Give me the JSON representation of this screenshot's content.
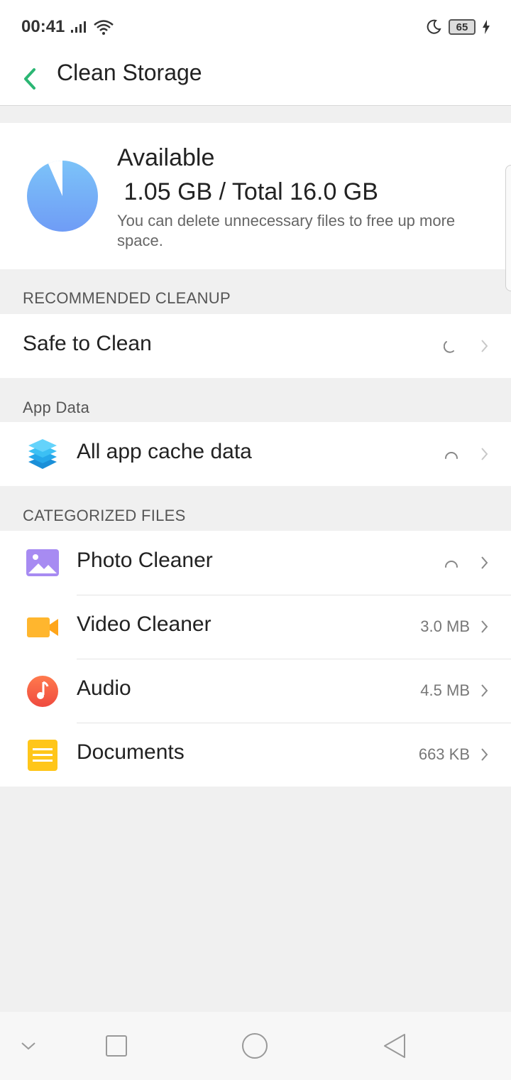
{
  "status_bar": {
    "time": "00:41",
    "battery_level": "65",
    "icons": [
      "signal-icon",
      "wifi-icon",
      "moon-icon",
      "battery-icon",
      "charging-icon"
    ]
  },
  "header": {
    "title": "Clean Storage",
    "back_icon": "back-arrow-icon"
  },
  "storage": {
    "available_label": "Available",
    "usage_text": " 1.05 GB / Total 16.0 GB",
    "description": "You can delete unnecessary files to free up more space.",
    "available_gb": 1.05,
    "total_gb": 16.0
  },
  "sections": {
    "recommended": "RECOMMENDED CLEANUP",
    "app_data": "App Data",
    "categorized": "CATEGORIZED FILES"
  },
  "rows": {
    "safe_to_clean": {
      "label": "Safe to Clean"
    },
    "app_cache": {
      "label": "All app cache data",
      "icon": "layers-icon"
    },
    "photo": {
      "label": "Photo Cleaner",
      "icon": "photo-icon"
    },
    "video": {
      "label": "Video Cleaner",
      "value": "3.0 MB",
      "icon": "video-icon"
    },
    "audio": {
      "label": "Audio",
      "value": "4.5 MB",
      "icon": "music-icon"
    },
    "documents": {
      "label": "Documents",
      "value": "663 KB",
      "icon": "document-icon"
    }
  },
  "colors": {
    "accent_green": "#2bb673",
    "pie_blue": "#74b3f7",
    "photo_purple": "#a78bf2",
    "video_orange": "#ffb62e",
    "audio_red": "#f25c45",
    "doc_yellow": "#ffc61a"
  }
}
